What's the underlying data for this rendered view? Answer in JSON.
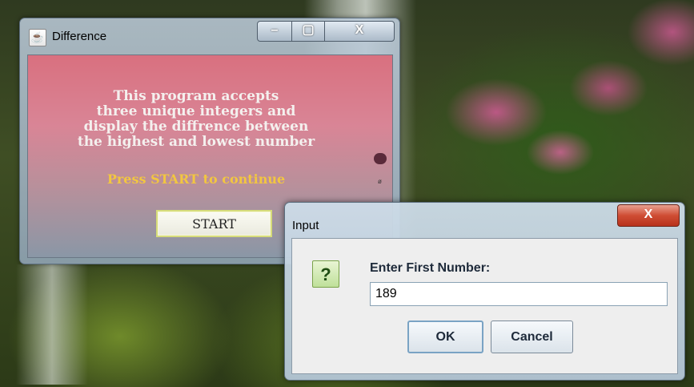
{
  "difference_window": {
    "title": "Difference",
    "icon": "java-cup-icon",
    "controls": {
      "minimize": "–",
      "maximize": "▢",
      "close": "X"
    },
    "message_lines": [
      "This program accepts",
      "three unique integers and",
      "display the diffrence between",
      "the highest and lowest number"
    ],
    "prompt": "Press START to continue",
    "start_label": "START",
    "small_badge_text": "ø"
  },
  "input_dialog": {
    "title": "Input",
    "close_label": "X",
    "icon": "question-icon",
    "icon_glyph": "?",
    "prompt_label": "Enter First Number:",
    "value": "189",
    "ok_label": "OK",
    "cancel_label": "Cancel"
  },
  "colors": {
    "prompt_yellow": "#f2c640",
    "close_red": "#cf4d34"
  }
}
